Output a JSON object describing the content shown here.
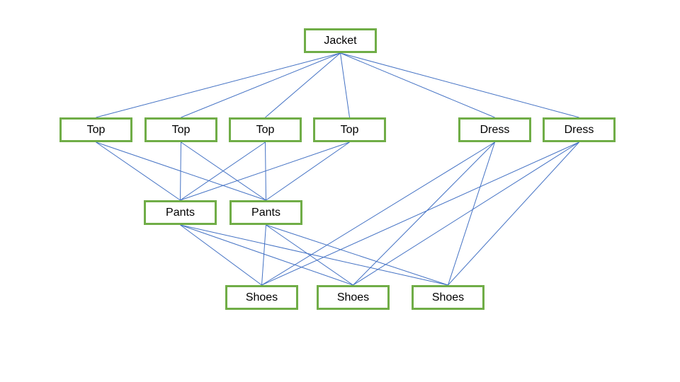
{
  "colors": {
    "node_border": "#70AD47",
    "edge": "#4472C4"
  },
  "nodes": [
    {
      "id": "jacket",
      "label": "Jacket"
    },
    {
      "id": "top1",
      "label": "Top"
    },
    {
      "id": "top2",
      "label": "Top"
    },
    {
      "id": "top3",
      "label": "Top"
    },
    {
      "id": "top4",
      "label": "Top"
    },
    {
      "id": "dress1",
      "label": "Dress"
    },
    {
      "id": "dress2",
      "label": "Dress"
    },
    {
      "id": "pants1",
      "label": "Pants"
    },
    {
      "id": "pants2",
      "label": "Pants"
    },
    {
      "id": "shoes1",
      "label": "Shoes"
    },
    {
      "id": "shoes2",
      "label": "Shoes"
    },
    {
      "id": "shoes3",
      "label": "Shoes"
    }
  ],
  "edges": [
    [
      "jacket",
      "top1"
    ],
    [
      "jacket",
      "top2"
    ],
    [
      "jacket",
      "top3"
    ],
    [
      "jacket",
      "top4"
    ],
    [
      "jacket",
      "dress1"
    ],
    [
      "jacket",
      "dress2"
    ],
    [
      "top1",
      "pants1"
    ],
    [
      "top1",
      "pants2"
    ],
    [
      "top2",
      "pants1"
    ],
    [
      "top2",
      "pants2"
    ],
    [
      "top3",
      "pants1"
    ],
    [
      "top3",
      "pants2"
    ],
    [
      "top4",
      "pants1"
    ],
    [
      "top4",
      "pants2"
    ],
    [
      "pants1",
      "shoes1"
    ],
    [
      "pants1",
      "shoes2"
    ],
    [
      "pants1",
      "shoes3"
    ],
    [
      "pants2",
      "shoes1"
    ],
    [
      "pants2",
      "shoes2"
    ],
    [
      "pants2",
      "shoes3"
    ],
    [
      "dress1",
      "shoes1"
    ],
    [
      "dress1",
      "shoes2"
    ],
    [
      "dress1",
      "shoes3"
    ],
    [
      "dress2",
      "shoes1"
    ],
    [
      "dress2",
      "shoes2"
    ],
    [
      "dress2",
      "shoes3"
    ]
  ]
}
